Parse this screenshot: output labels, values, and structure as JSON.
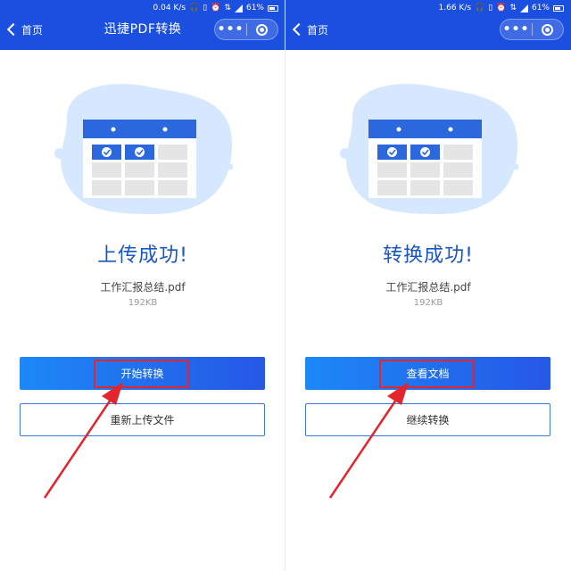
{
  "colors": {
    "header_bg": "#1b4fe0",
    "accent": "#1a55c4",
    "highlight": "#e3262d"
  },
  "left": {
    "status_bar": {
      "speed": "0.04 K/s",
      "battery": "61%"
    },
    "nav": {
      "back_label": "首页",
      "title": "迅捷PDF转换",
      "more_icon": "more-dots-icon",
      "close_icon": "close-circle-icon"
    },
    "illustration": "document-table-icon",
    "status_title": "上传成功!",
    "file_name": "工作汇报总结.pdf",
    "file_size": "192KB",
    "primary_button": "开始转换",
    "secondary_button": "重新上传文件"
  },
  "right": {
    "status_bar": {
      "speed": "1.66 K/s",
      "battery": "61%"
    },
    "nav": {
      "back_label": "首页",
      "title": "",
      "more_icon": "more-dots-icon",
      "close_icon": "close-circle-icon"
    },
    "illustration": "document-table-icon",
    "status_title": "转换成功!",
    "file_name": "工作汇报总结.pdf",
    "file_size": "192KB",
    "primary_button": "查看文档",
    "secondary_button": "继续转换"
  }
}
